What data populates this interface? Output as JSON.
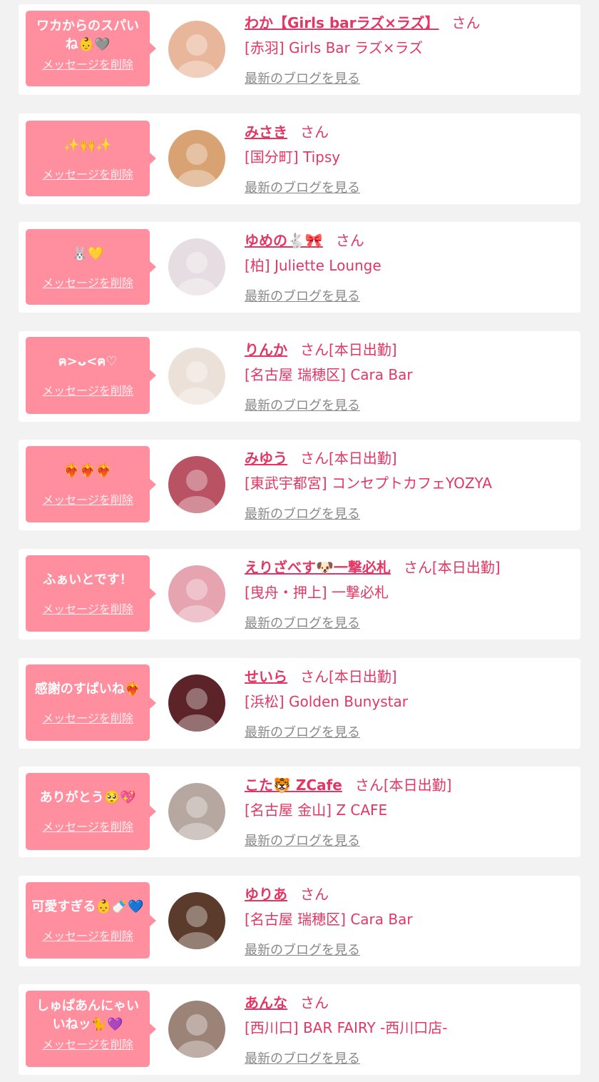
{
  "delete_label": "メッセージを削除",
  "blog_label": "最新のブログを見る",
  "honorific": "さん",
  "colors": {
    "page_bg": "#f2f2f2",
    "bubble": "#ff8e9e",
    "accent": "#e23764",
    "link_gray": "#888888"
  },
  "items": [
    {
      "message": "ワカからのスパいね👶🩶",
      "name": "わか【Girls barラズ×ラズ】",
      "badge": "",
      "shop": "[赤羽] Girls Bar ラズ×ラズ",
      "avatar_color": "#e8b69a"
    },
    {
      "message": "✨🙌✨",
      "name": "みさき",
      "badge": "",
      "shop": "[国分町] Tipsy",
      "avatar_color": "#d8a273"
    },
    {
      "message": "🐰💛",
      "name": "ゆめの🐇🎀",
      "badge": "",
      "shop": "[柏] Juliette Lounge",
      "avatar_color": "#e6dde2"
    },
    {
      "message": "ฅ>ᴗ<ฅ♡",
      "name": "りんか",
      "badge": "[本日出勤]",
      "shop": "[名古屋 瑞穂区] Cara Bar",
      "avatar_color": "#ece1d9"
    },
    {
      "message": "❤️‍🔥❤️‍🔥❤️‍🔥",
      "name": "みゆう",
      "badge": "[本日出勤]",
      "shop": "[東武宇都宮] コンセプトカフェYOZYA",
      "avatar_color": "#b95262"
    },
    {
      "message": "ふぁいとです！",
      "name": "えりざべす🐶一撃必札",
      "badge": "[本日出勤]",
      "shop": "[曳舟・押上] 一撃必札",
      "avatar_color": "#e6a4b0"
    },
    {
      "message": "感謝のすぱいね❤️‍🔥",
      "name": "せいら",
      "badge": "[本日出勤]",
      "shop": "[浜松] Golden Bunystar",
      "avatar_color": "#5c2428"
    },
    {
      "message": "ありがとう🥺💖",
      "name": "こた🐯 ZCafe",
      "badge": "[本日出勤]",
      "shop": "[名古屋 金山] Z CAFE",
      "avatar_color": "#b6a8a0"
    },
    {
      "message": "可愛すぎる👶🍼💙",
      "name": "ゆりあ",
      "badge": "",
      "shop": "[名古屋 瑞穂区] Cara Bar",
      "avatar_color": "#5b3b2c"
    },
    {
      "message": "しゅぱあんにゃいいねッ🐈💜",
      "name": "あんな",
      "badge": "",
      "shop": "[西川口] BAR FAIRY -西川口店-",
      "avatar_color": "#9b8378"
    }
  ]
}
